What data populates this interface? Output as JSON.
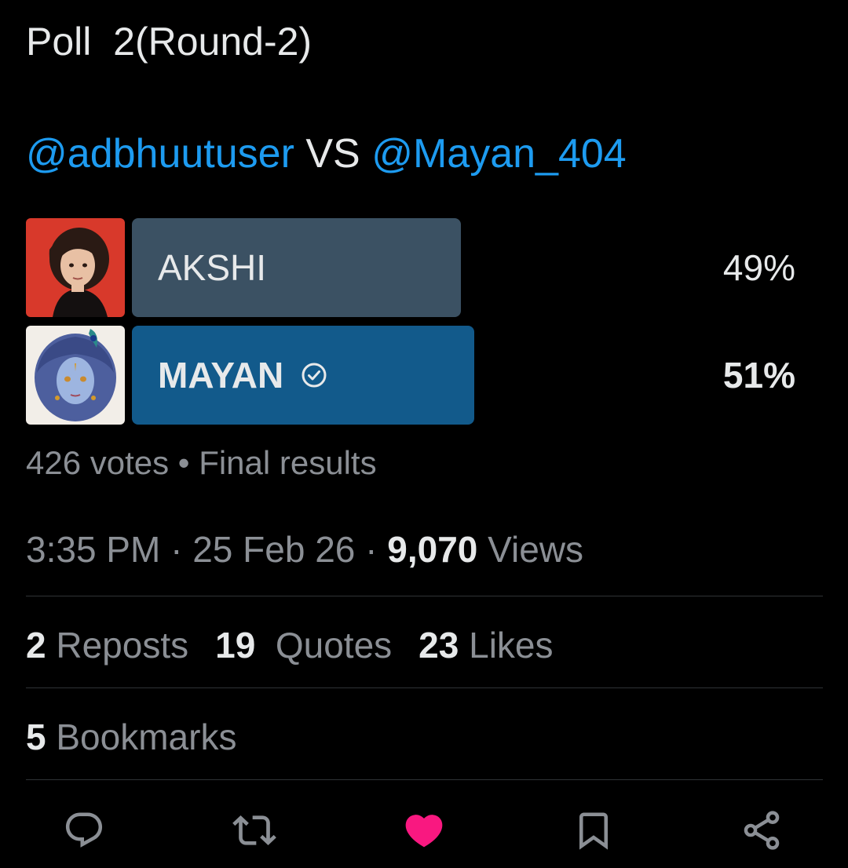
{
  "tweet": {
    "text": "Poll  2(Round-2)",
    "mention_left": "@adbhuutuser",
    "vs": " VS ",
    "mention_right": "@Mayan_404"
  },
  "poll": {
    "options": [
      {
        "label": "AKSHI",
        "percent_text": "49%",
        "percent": 49,
        "bar_color": "#3b5163",
        "winner": false
      },
      {
        "label": "MAYAN",
        "percent_text": "51%",
        "percent": 51,
        "bar_color": "#125a8b",
        "winner": true
      }
    ],
    "votes": "426 votes",
    "separator": " • ",
    "status": "Final results",
    "winner_icon": "check-circle-icon"
  },
  "meta": {
    "time": "3:35 PM",
    "dot": " · ",
    "date": "25 Feb 26",
    "views_count": "9,070",
    "views_label": " Views"
  },
  "stats": {
    "reposts_count": "2",
    "reposts_label": " Reposts",
    "quotes_count": "19",
    "quotes_label": "  Quotes",
    "likes_count": "23",
    "likes_label": " Likes",
    "bookmarks_count": "5",
    "bookmarks_label": " Bookmarks"
  },
  "actions": [
    {
      "icon": "reply-icon"
    },
    {
      "icon": "repost-icon"
    },
    {
      "icon": "heart-icon",
      "active_color": "#f91880"
    },
    {
      "icon": "bookmark-icon"
    },
    {
      "icon": "share-icon"
    }
  ],
  "colors": {
    "background": "#000000",
    "text": "#e7e9ea",
    "secondary": "#8b8f95",
    "link": "#1d9bf0",
    "divider": "#2f3336"
  }
}
